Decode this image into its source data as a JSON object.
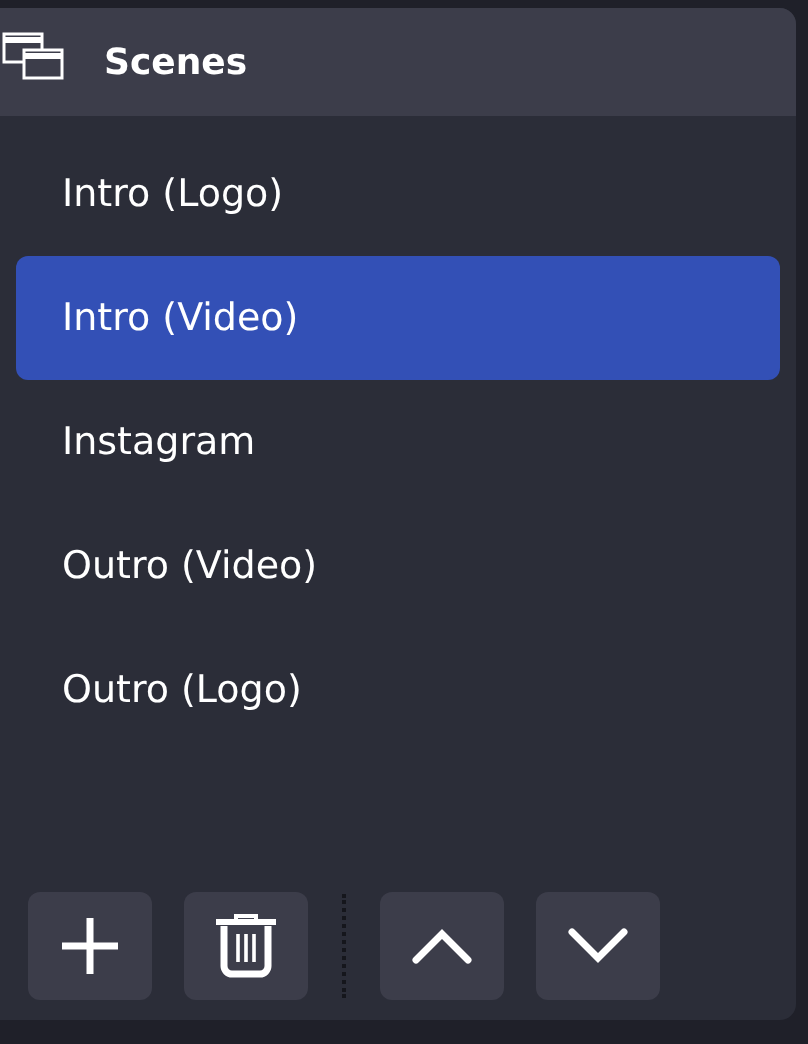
{
  "dock": {
    "title": "Scenes"
  },
  "scenes": [
    {
      "name": "Intro (Logo)",
      "selected": false
    },
    {
      "name": "Intro (Video)",
      "selected": true
    },
    {
      "name": "Instagram",
      "selected": false
    },
    {
      "name": "Outro (Video)",
      "selected": false
    },
    {
      "name": "Outro (Logo)",
      "selected": false
    }
  ]
}
